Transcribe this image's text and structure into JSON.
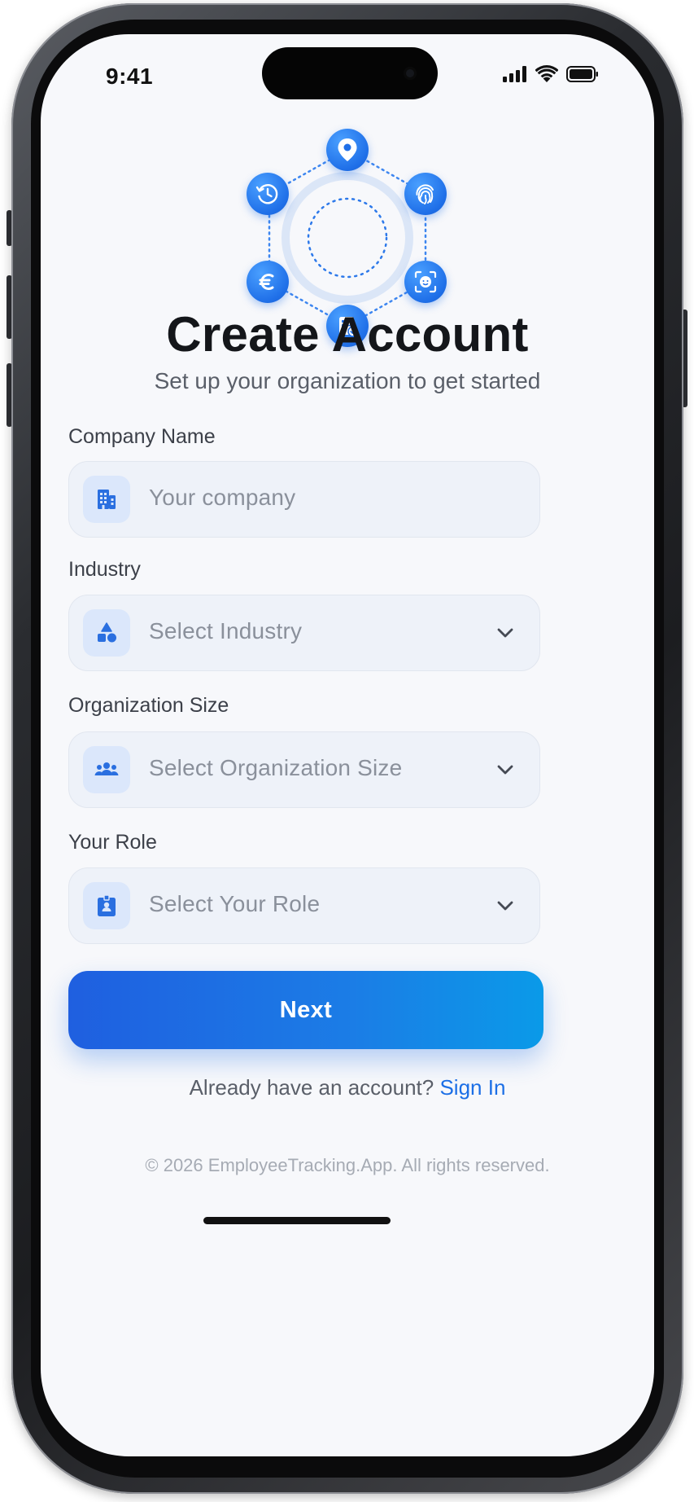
{
  "status_bar": {
    "time": "9:41"
  },
  "header": {
    "title": "Create Account",
    "subtitle": "Set up your organization to get started"
  },
  "hero": {
    "icons": [
      "location-pin-icon",
      "fingerprint-icon",
      "face-id-icon",
      "checklist-icon",
      "euro-icon",
      "time-history-icon"
    ],
    "accent": "#1f6fe8"
  },
  "form": {
    "company_name": {
      "label": "Company Name",
      "placeholder": "Your company",
      "icon": "building-icon"
    },
    "industry": {
      "label": "Industry",
      "placeholder": "Select Industry",
      "icon": "shapes-icon"
    },
    "organization_size": {
      "label": "Organization Size",
      "placeholder": "Select Organization Size",
      "icon": "team-icon"
    },
    "role": {
      "label": "Your Role",
      "placeholder": "Select Your Role",
      "icon": "id-badge-icon"
    }
  },
  "actions": {
    "next_label": "Next",
    "signin_prompt": "Already have an account?",
    "signin_link": "Sign In"
  },
  "footer": {
    "copyright": "© 2026 EmployeeTracking.App. All rights reserved."
  },
  "colors": {
    "primary": "#1f6fe8",
    "link": "#1c6fe6",
    "field_bg": "#eef2f9"
  }
}
